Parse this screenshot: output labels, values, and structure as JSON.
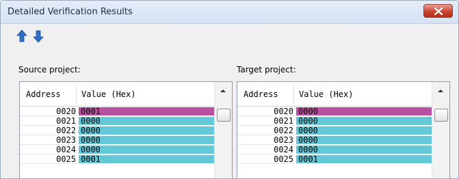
{
  "window": {
    "title": "Detailed Verification Results"
  },
  "toolbar": {
    "up_icon": "arrow-up-icon",
    "down_icon": "arrow-down-icon"
  },
  "source": {
    "label": "Source project:",
    "columns": {
      "address": "Address",
      "value": "Value (Hex)"
    },
    "rows": [
      {
        "address": "0020",
        "value": "0001",
        "status": "diff"
      },
      {
        "address": "0021",
        "value": "0000",
        "status": "same"
      },
      {
        "address": "0022",
        "value": "0000",
        "status": "same"
      },
      {
        "address": "0023",
        "value": "0000",
        "status": "same"
      },
      {
        "address": "0024",
        "value": "0000",
        "status": "same"
      },
      {
        "address": "0025",
        "value": "0001",
        "status": "same"
      }
    ]
  },
  "target": {
    "label": "Target project:",
    "columns": {
      "address": "Address",
      "value": "Value (Hex)"
    },
    "rows": [
      {
        "address": "0020",
        "value": "0000",
        "status": "diff"
      },
      {
        "address": "0021",
        "value": "0000",
        "status": "same"
      },
      {
        "address": "0022",
        "value": "0000",
        "status": "same"
      },
      {
        "address": "0023",
        "value": "0000",
        "status": "same"
      },
      {
        "address": "0024",
        "value": "0000",
        "status": "same"
      },
      {
        "address": "0025",
        "value": "0001",
        "status": "same"
      }
    ]
  },
  "colors": {
    "diff": "#b6509f",
    "same": "#63c9d8",
    "close": "#c9452f"
  }
}
